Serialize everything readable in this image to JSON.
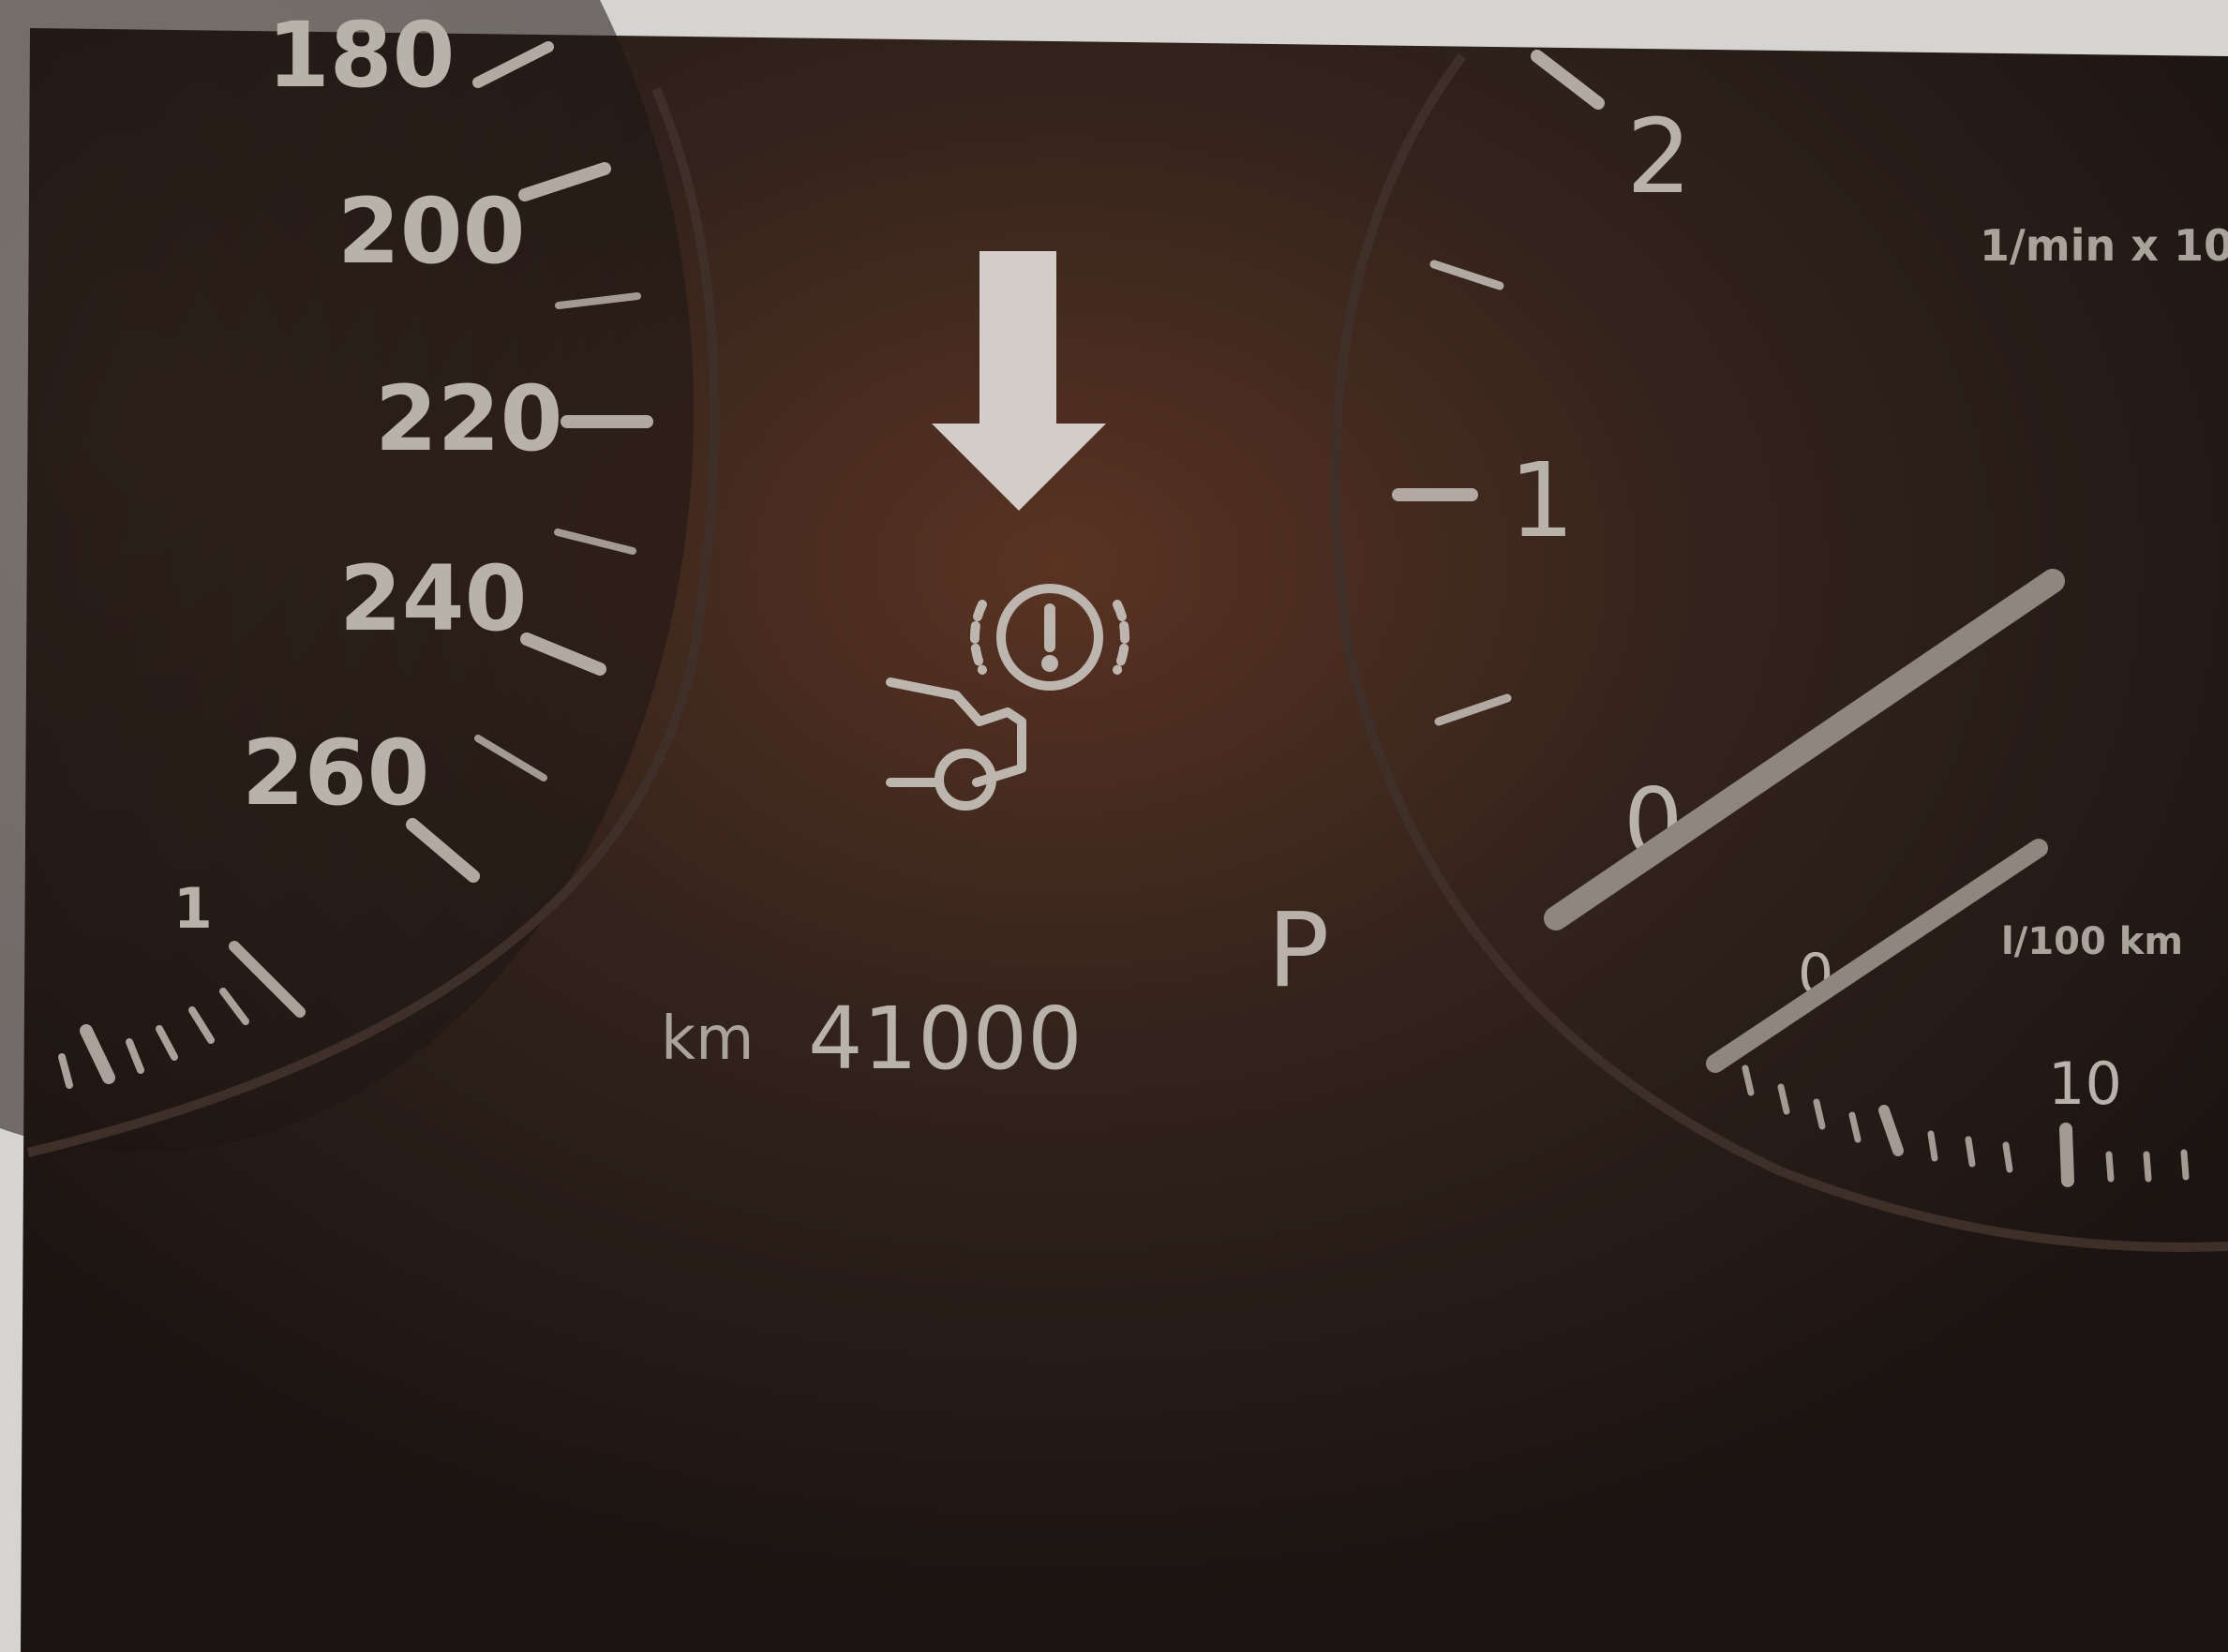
{
  "speedometer": {
    "labels": [
      "180",
      "200",
      "220",
      "240",
      "260"
    ],
    "fuel_mark": "1"
  },
  "odometer": {
    "unit": "km",
    "value": "41000"
  },
  "gear": "P",
  "tachometer": {
    "labels": [
      "2",
      "1",
      "0"
    ],
    "unit": "1/min x 10"
  },
  "consumption": {
    "zero": "0",
    "unit": "l/100 km",
    "ten": "10"
  },
  "warning": {
    "icon": "parking-brake-failure-icon",
    "pointer": "arrow-down-icon"
  },
  "colors": {
    "panel": "#261c18",
    "glow": "#5a3322",
    "markings": "#b9b2aa",
    "needle": "#8f877d"
  }
}
